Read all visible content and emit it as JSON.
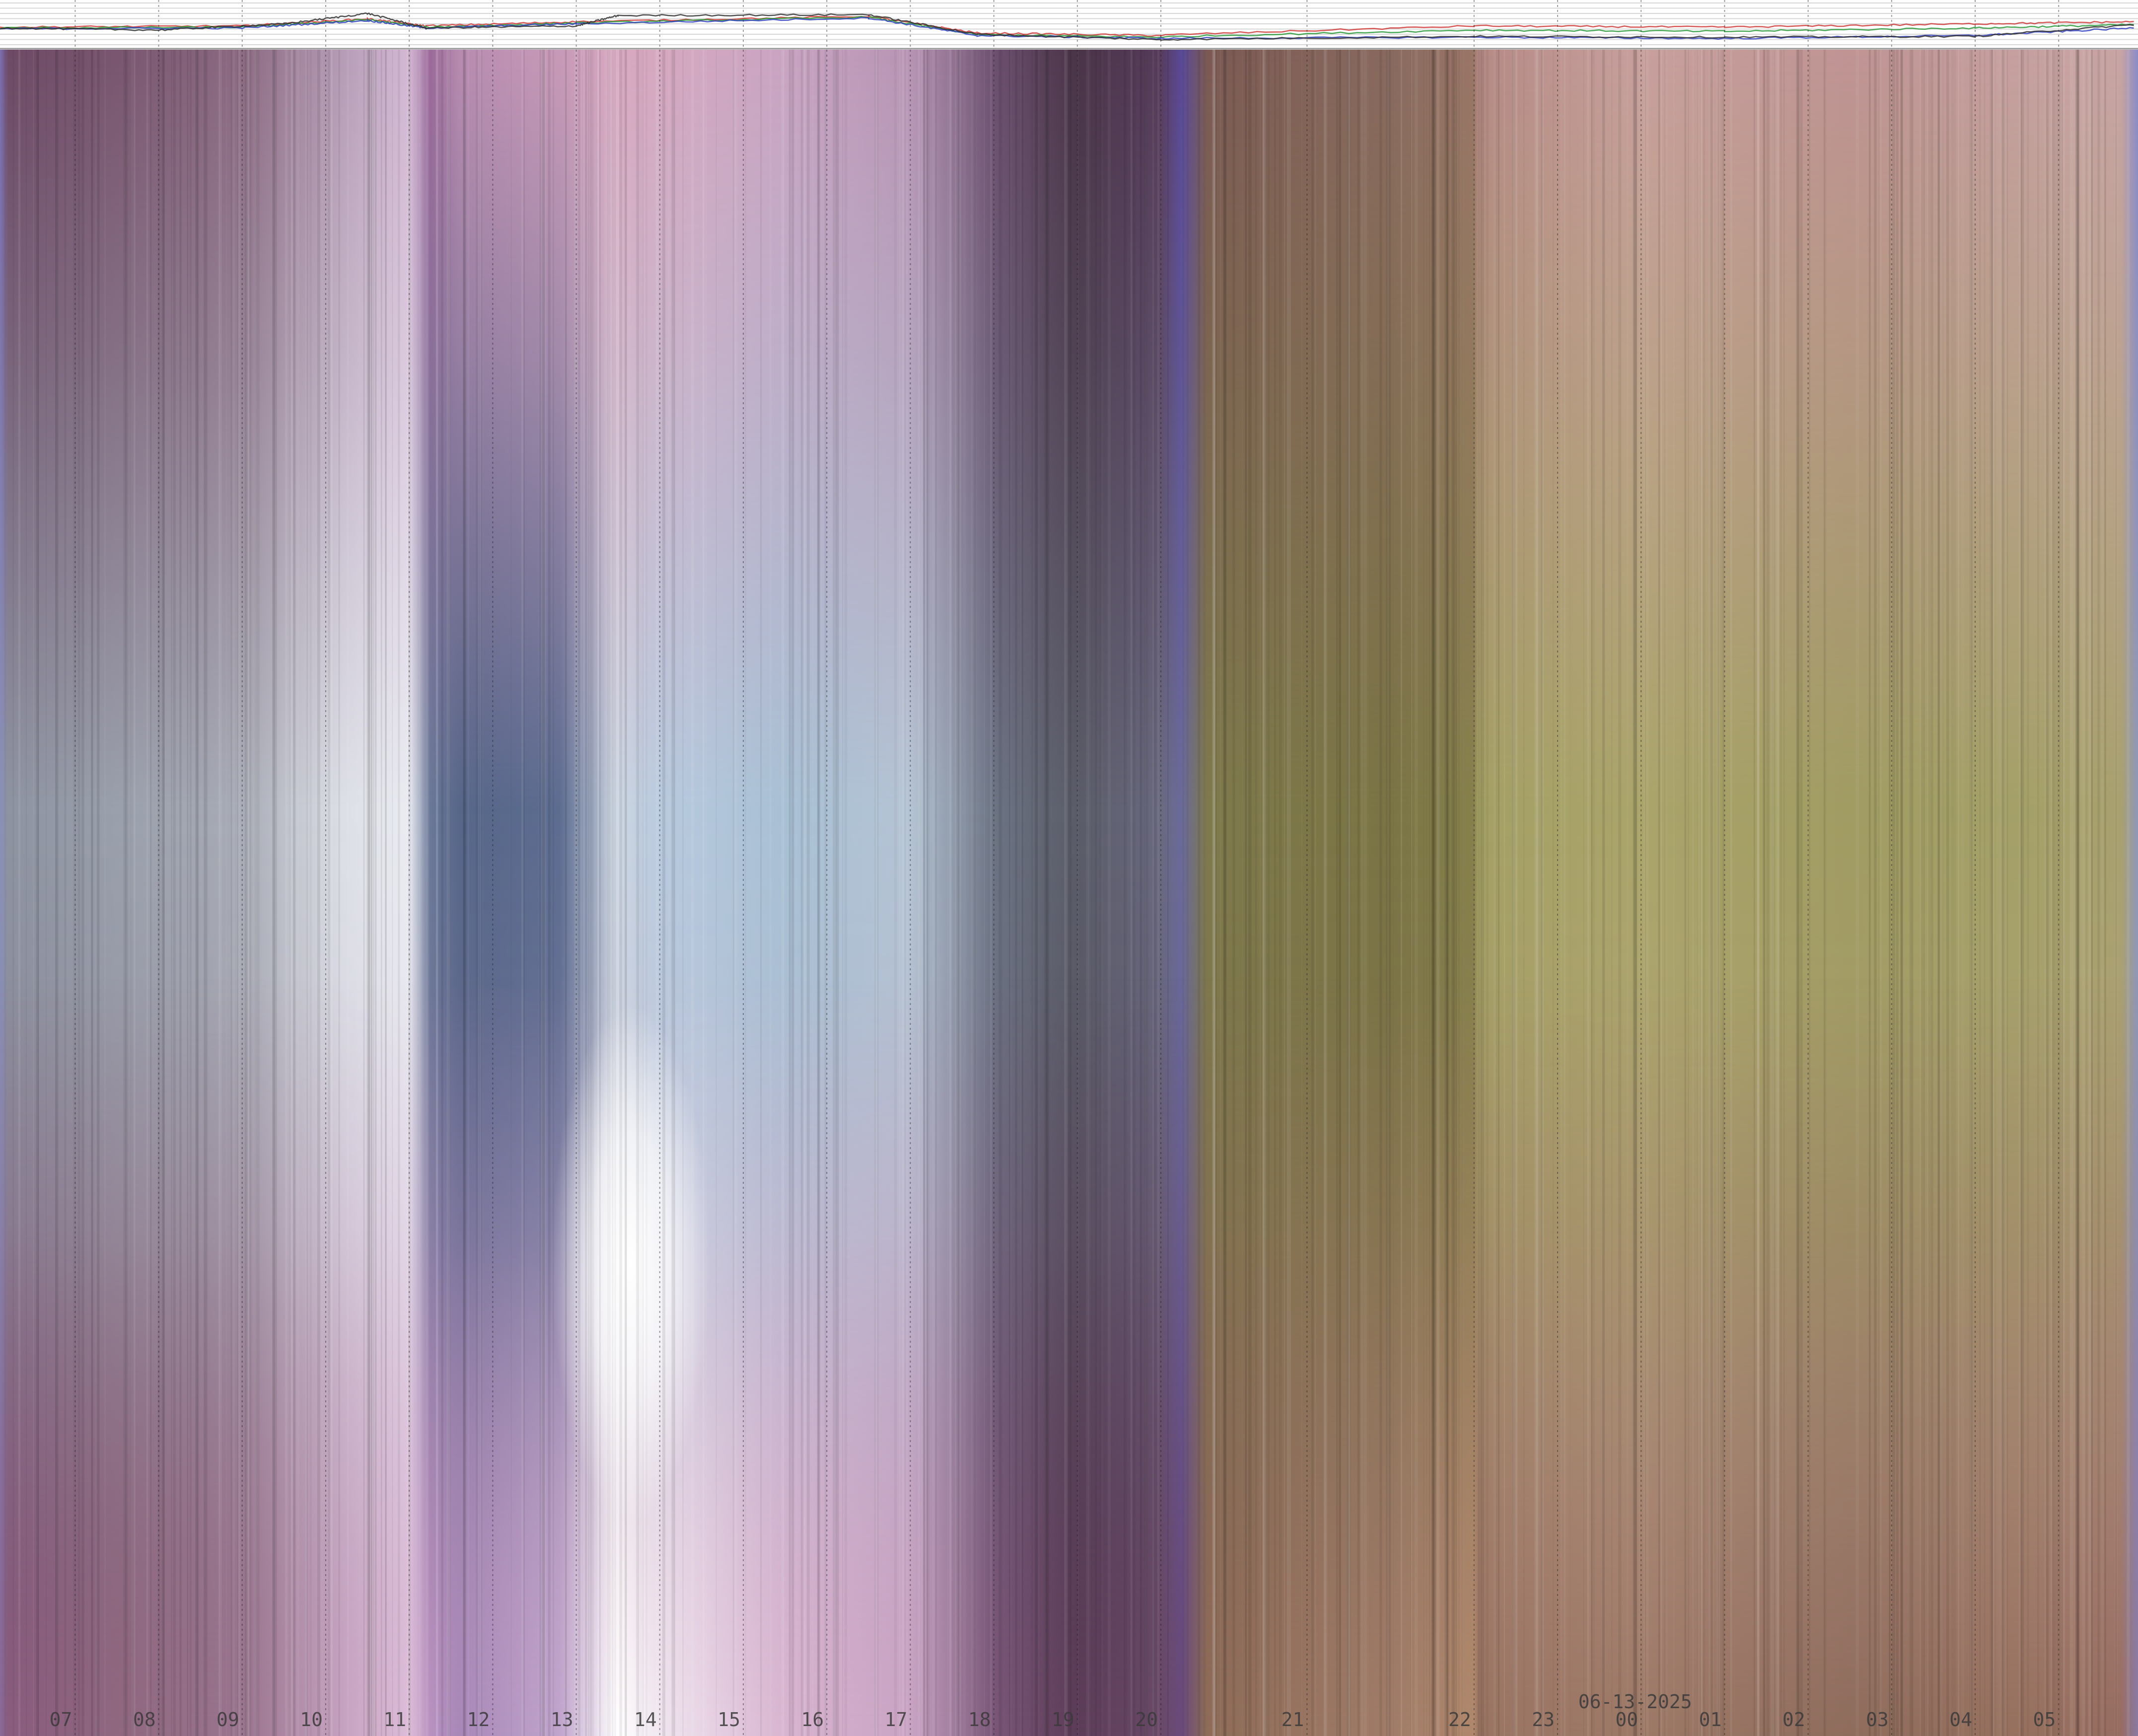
{
  "chart_data": {
    "type": "heatmap",
    "description_note": "",
    "date_label": "06-13-2025",
    "x_tick_labels": [
      "07",
      "08",
      "09",
      "10",
      "11",
      "12",
      "13",
      "14",
      "15",
      "16",
      "17",
      "18",
      "19",
      "20",
      "21",
      "22",
      "23",
      "00",
      "01",
      "02",
      "03",
      "04",
      "05"
    ],
    "x_tick_hours": [
      7,
      8,
      9,
      10,
      11,
      12,
      13,
      14,
      15,
      16,
      17,
      18,
      19,
      20,
      21,
      22,
      23,
      24,
      25,
      26,
      27,
      28,
      29
    ],
    "x_range_hours": [
      6.1,
      29.95
    ],
    "time_segments": [
      {
        "start": 6.1,
        "end": 20.25,
        "interval_hours": 1.0
      },
      {
        "start": 20.25,
        "end": 22.0,
        "interval_hours": 0.5
      },
      {
        "start": 22.0,
        "end": 29.95,
        "interval_hours": 1.0
      }
    ],
    "keogram_color_stops": [
      {
        "hour": 6.1,
        "top": "#7a6fb0",
        "mid": "#8a90b8",
        "bottom": "#8a6a98"
      },
      {
        "hour": 6.2,
        "top": "#6e4a66",
        "mid": "#8e94a2",
        "bottom": "#8a5c7e"
      },
      {
        "hour": 7.5,
        "top": "#7a5670",
        "mid": "#9aa0ac",
        "bottom": "#906880"
      },
      {
        "hour": 9.0,
        "top": "#8c6a82",
        "mid": "#a8acb6",
        "bottom": "#9a748e"
      },
      {
        "hour": 10.2,
        "top": "#b69cb6",
        "mid": "#dcdfe6",
        "bottom": "#c6a2c0"
      },
      {
        "hour": 11.0,
        "top": "#d4b8d4",
        "mid": "#eaecf2",
        "bottom": "#dcbcd8"
      },
      {
        "hour": 11.25,
        "top": "#9c6a9a",
        "mid": "#6a7898",
        "bottom": "#b892c0"
      },
      {
        "hour": 11.6,
        "top": "#b88cb0",
        "mid": "#566688",
        "bottom": "#a888b8"
      },
      {
        "hour": 12.8,
        "top": "#c89ab8",
        "mid": "#5c6c90",
        "bottom": "#c0a4cc"
      },
      {
        "hour": 13.5,
        "top": "#d8a8c0",
        "mid": "#ccd6e2",
        "bottom": "#ffffff"
      },
      {
        "hour": 14.0,
        "top": "#d6a8c0",
        "mid": "#b8cade",
        "bottom": "#f0e6f0"
      },
      {
        "hour": 15.5,
        "top": "#caa4c2",
        "mid": "#a8c0d4",
        "bottom": "#d8b4d0"
      },
      {
        "hour": 17.0,
        "top": "#b894b4",
        "mid": "#b4c4d4",
        "bottom": "#caa4c4"
      },
      {
        "hour": 18.0,
        "top": "#6e5070",
        "mid": "#6c7484",
        "bottom": "#7a5678"
      },
      {
        "hour": 19.0,
        "top": "#4a3448",
        "mid": "#5a5c68",
        "bottom": "#5c3c58"
      },
      {
        "hour": 20.0,
        "top": "#583c5c",
        "mid": "#6a6a80",
        "bottom": "#6a4a68"
      },
      {
        "hour": 20.25,
        "top": "#5a4a98",
        "mid": "#6a6a9a",
        "bottom": "#6a4a7a"
      },
      {
        "hour": 20.4,
        "top": "#7c5a54",
        "mid": "#7e7a4c",
        "bottom": "#8e6c58"
      },
      {
        "hour": 21.5,
        "top": "#8a6a60",
        "mid": "#7a7444",
        "bottom": "#a07c68"
      },
      {
        "hour": 22.0,
        "top": "#9a7668",
        "mid": "#86804c",
        "bottom": "#b0886c"
      },
      {
        "hour": 22.05,
        "top": "#b68a86",
        "mid": "#a4a064",
        "bottom": "#9a7462"
      },
      {
        "hour": 24.0,
        "top": "#c8a09e",
        "mid": "#aaa46a",
        "bottom": "#9c7866"
      },
      {
        "hour": 26.5,
        "top": "#c09494",
        "mid": "#a09c62",
        "bottom": "#8e6c5c"
      },
      {
        "hour": 28.5,
        "top": "#c6a0a0",
        "mid": "#a4a068",
        "bottom": "#96705e"
      },
      {
        "hour": 29.75,
        "top": "#c8a4a4",
        "mid": "#a8a06e",
        "bottom": "#966c60"
      },
      {
        "hour": 29.95,
        "top": "#8a8cc8",
        "mid": "#8e98b8",
        "bottom": "#8a78a0"
      }
    ],
    "series": [
      {
        "color": "#d03838",
        "values": [
          [
            6.1,
            0.42
          ],
          [
            9,
            0.45
          ],
          [
            10.5,
            0.62
          ],
          [
            11.2,
            0.45
          ],
          [
            13,
            0.55
          ],
          [
            16.5,
            0.68
          ],
          [
            17.8,
            0.28
          ],
          [
            20,
            0.22
          ],
          [
            22,
            0.45
          ],
          [
            25,
            0.42
          ],
          [
            28,
            0.5
          ],
          [
            29.9,
            0.55
          ]
        ]
      },
      {
        "color": "#2a9a3a",
        "values": [
          [
            6.1,
            0.4
          ],
          [
            9,
            0.42
          ],
          [
            10.5,
            0.6
          ],
          [
            11.2,
            0.42
          ],
          [
            13,
            0.52
          ],
          [
            16.5,
            0.66
          ],
          [
            17.8,
            0.24
          ],
          [
            20,
            0.18
          ],
          [
            22,
            0.35
          ],
          [
            25,
            0.32
          ],
          [
            28,
            0.4
          ],
          [
            29.9,
            0.48
          ]
        ]
      },
      {
        "color": "#3040c0",
        "values": [
          [
            6.1,
            0.38
          ],
          [
            9,
            0.4
          ],
          [
            10.5,
            0.58
          ],
          [
            11.2,
            0.4
          ],
          [
            13,
            0.5
          ],
          [
            16.5,
            0.64
          ],
          [
            17.8,
            0.22
          ],
          [
            20,
            0.15
          ],
          [
            22,
            0.18
          ],
          [
            25,
            0.15
          ],
          [
            28,
            0.22
          ],
          [
            29.9,
            0.4
          ]
        ]
      },
      {
        "color": "#303030",
        "values": [
          [
            6.1,
            0.4
          ],
          [
            8,
            0.35
          ],
          [
            9.5,
            0.5
          ],
          [
            10.5,
            0.75
          ],
          [
            11.2,
            0.4
          ],
          [
            13,
            0.45
          ],
          [
            13.5,
            0.7
          ],
          [
            16.5,
            0.72
          ],
          [
            17.8,
            0.25
          ],
          [
            20,
            0.12
          ],
          [
            22,
            0.2
          ],
          [
            25,
            0.18
          ],
          [
            28,
            0.2
          ],
          [
            29.9,
            0.48
          ]
        ]
      }
    ],
    "grid": true,
    "legend": "none"
  }
}
